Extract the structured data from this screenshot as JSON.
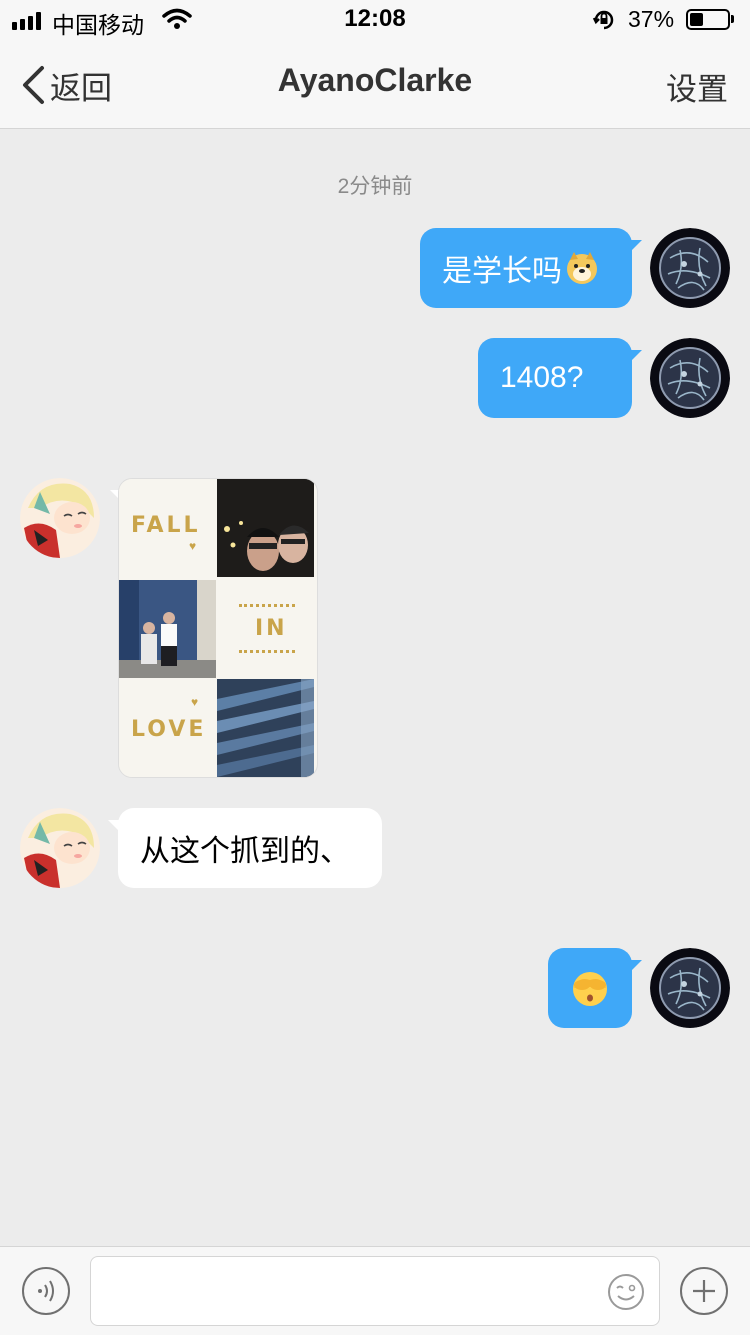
{
  "status_bar": {
    "carrier": "中国移动",
    "time": "12:08",
    "battery_percent": "37%",
    "battery_level": 0.37
  },
  "nav": {
    "back_label": "返回",
    "title": "AyanoClarke",
    "right_label": "设置"
  },
  "timestamp": "2分钟前",
  "messages": [
    {
      "direction": "out",
      "text": "是学长吗",
      "emoji": "doge"
    },
    {
      "direction": "out",
      "text": "1408?"
    },
    {
      "direction": "in",
      "type": "image",
      "image_words": [
        "FALL",
        "IN",
        "LOVE"
      ]
    },
    {
      "direction": "in",
      "text": "从这个抓到的、"
    },
    {
      "direction": "out",
      "emoji": "face-covering-eyes"
    }
  ],
  "input": {
    "placeholder": ""
  },
  "icons": {
    "voice": "voice-icon",
    "emoji": "emoji-icon",
    "add": "plus-icon"
  },
  "colors": {
    "outgoing_bubble": "#3fa8f8",
    "incoming_bubble": "#ffffff",
    "background": "#ececec"
  }
}
